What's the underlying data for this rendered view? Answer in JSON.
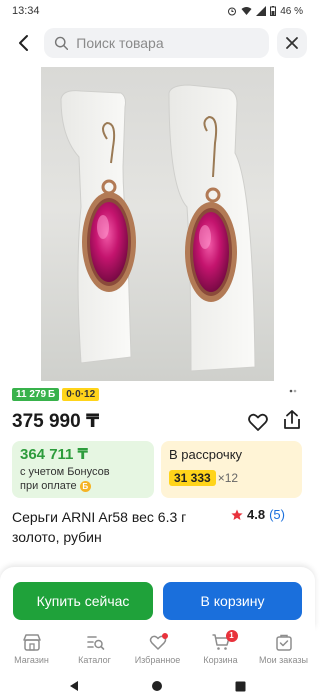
{
  "status_bar": {
    "time": "13:34",
    "battery": "46 %"
  },
  "search": {
    "placeholder": "Поиск товара"
  },
  "badges": {
    "green": "11 279",
    "green_suffix": "Б",
    "yellow": "0·0·12"
  },
  "product": {
    "price": "375 990 ₸",
    "title": "Серьги ARNI Ar58 вес 6.3 г золото, рубин",
    "rating": "4.8",
    "reviews": "(5)"
  },
  "bonus": {
    "price": "364 711 ₸",
    "note_line1": "с учетом Бонусов",
    "note_line2": "при оплате",
    "coin": "Б"
  },
  "installment": {
    "title": "В рассрочку",
    "amount": "31 333",
    "times": "×12"
  },
  "actions": {
    "buy_now": "Купить сейчас",
    "add_to_cart": "В корзину"
  },
  "nav": {
    "items": [
      {
        "label": "Магазин",
        "icon": "store-icon"
      },
      {
        "label": "Каталог",
        "icon": "catalog-icon"
      },
      {
        "label": "Избранное",
        "icon": "heart-icon"
      },
      {
        "label": "Корзина",
        "icon": "cart-icon"
      },
      {
        "label": "Мои заказы",
        "icon": "orders-icon"
      }
    ],
    "cart_count": "1"
  },
  "colors": {
    "green": "#1fa23a",
    "blue": "#1a6fdc",
    "yellow": "#ffd41a",
    "ruby": "#c4146e",
    "gold": "#c08a5a"
  }
}
